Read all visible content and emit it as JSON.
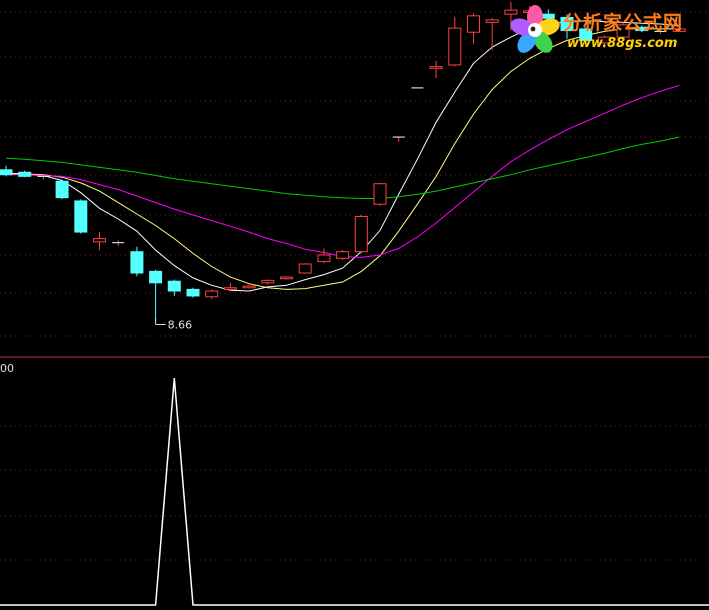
{
  "chart_data": [
    {
      "type": "candlestick",
      "title": "",
      "ylim": [
        8.3,
        12.5
      ],
      "bull_color": "#ff4040",
      "bear_color": "#54ffff",
      "min_marker": {
        "index": 8,
        "label": "8.66"
      },
      "candles": [
        {
          "o": 10.5,
          "h": 10.55,
          "l": 10.42,
          "c": 10.44
        },
        {
          "o": 10.47,
          "h": 10.49,
          "l": 10.41,
          "c": 10.42
        },
        {
          "o": 10.42,
          "h": 10.44,
          "l": 10.38,
          "c": 10.42
        },
        {
          "o": 10.36,
          "h": 10.38,
          "l": 10.14,
          "c": 10.16
        },
        {
          "o": 10.12,
          "h": 10.14,
          "l": 9.72,
          "c": 9.74
        },
        {
          "o": 9.62,
          "h": 9.74,
          "l": 9.52,
          "c": 9.66
        },
        {
          "o": 9.6,
          "h": 9.64,
          "l": 9.57,
          "c": 9.61
        },
        {
          "o": 9.5,
          "h": 9.56,
          "l": 9.2,
          "c": 9.24
        },
        {
          "o": 9.26,
          "h": 9.28,
          "l": 8.66,
          "c": 9.12
        },
        {
          "o": 9.14,
          "h": 9.16,
          "l": 8.96,
          "c": 9.02
        },
        {
          "o": 9.04,
          "h": 9.06,
          "l": 8.94,
          "c": 8.96
        },
        {
          "o": 8.95,
          "h": 9.04,
          "l": 8.92,
          "c": 9.02
        },
        {
          "o": 9.04,
          "h": 9.12,
          "l": 9.02,
          "c": 9.06
        },
        {
          "o": 9.06,
          "h": 9.1,
          "l": 9.05,
          "c": 9.08
        },
        {
          "o": 9.12,
          "h": 9.16,
          "l": 9.1,
          "c": 9.15
        },
        {
          "o": 9.17,
          "h": 9.2,
          "l": 9.16,
          "c": 9.19
        },
        {
          "o": 9.24,
          "h": 9.36,
          "l": 9.23,
          "c": 9.35
        },
        {
          "o": 9.38,
          "h": 9.54,
          "l": 9.36,
          "c": 9.46
        },
        {
          "o": 9.42,
          "h": 9.52,
          "l": 9.4,
          "c": 9.5
        },
        {
          "o": 9.5,
          "h": 9.95,
          "l": 9.48,
          "c": 9.93
        },
        {
          "o": 10.08,
          "h": 10.34,
          "l": 10.06,
          "c": 10.33
        },
        {
          "o": 10.9,
          "h": 10.9,
          "l": 10.84,
          "c": 10.9
        },
        {
          "o": 11.5,
          "h": 11.5,
          "l": 11.5,
          "c": 11.5
        },
        {
          "o": 11.74,
          "h": 11.83,
          "l": 11.62,
          "c": 11.76
        },
        {
          "o": 11.78,
          "h": 12.37,
          "l": 11.76,
          "c": 12.23
        },
        {
          "o": 12.18,
          "h": 12.41,
          "l": 12.04,
          "c": 12.38
        },
        {
          "o": 12.3,
          "h": 12.35,
          "l": 11.96,
          "c": 12.33
        },
        {
          "o": 12.4,
          "h": 12.55,
          "l": 12.2,
          "c": 12.45
        },
        {
          "o": 12.42,
          "h": 12.5,
          "l": 12.28,
          "c": 12.44
        },
        {
          "o": 12.4,
          "h": 12.46,
          "l": 12.3,
          "c": 12.35
        },
        {
          "o": 12.36,
          "h": 12.4,
          "l": 12.1,
          "c": 12.2
        },
        {
          "o": 12.22,
          "h": 12.24,
          "l": 12.02,
          "c": 12.08
        },
        {
          "o": 12.05,
          "h": 12.14,
          "l": 11.99,
          "c": 12.12
        },
        {
          "o": 12.12,
          "h": 12.3,
          "l": 12.1,
          "c": 12.27
        },
        {
          "o": 12.24,
          "h": 12.26,
          "l": 12.18,
          "c": 12.2
        },
        {
          "o": 12.18,
          "h": 12.2,
          "l": 12.16,
          "c": 12.19
        },
        {
          "o": 12.19,
          "h": 12.23,
          "l": 12.18,
          "c": 12.22
        }
      ],
      "ma_lines": [
        {
          "color": "#ffffff",
          "values": [
            10.45,
            10.44,
            10.43,
            10.37,
            10.22,
            10.03,
            9.9,
            9.75,
            9.52,
            9.33,
            9.18,
            9.09,
            9.03,
            9.02,
            9.07,
            9.09,
            9.16,
            9.22,
            9.3,
            9.5,
            9.76,
            10.2,
            10.63,
            11.08,
            11.45,
            11.8,
            12.0,
            12.12,
            12.23,
            12.29,
            12.3,
            12.32,
            12.31,
            12.3,
            12.29,
            12.28,
            12.26
          ]
        },
        {
          "color": "#ffff80",
          "values": [
            10.46,
            10.45,
            10.44,
            10.41,
            10.34,
            10.24,
            10.1,
            9.96,
            9.82,
            9.66,
            9.48,
            9.32,
            9.19,
            9.11,
            9.06,
            9.04,
            9.05,
            9.09,
            9.13,
            9.26,
            9.45,
            9.75,
            10.08,
            10.42,
            10.82,
            11.18,
            11.48,
            11.7,
            11.86,
            11.98,
            12.08,
            12.14,
            12.19,
            12.22,
            12.22,
            12.22,
            12.22
          ]
        },
        {
          "color": "#ff00ff",
          "values": [
            10.44,
            10.44,
            10.43,
            10.42,
            10.38,
            10.32,
            10.26,
            10.18,
            10.1,
            10.02,
            9.95,
            9.88,
            9.81,
            9.74,
            9.66,
            9.6,
            9.53,
            9.49,
            9.44,
            9.43,
            9.46,
            9.54,
            9.68,
            9.85,
            10.04,
            10.23,
            10.42,
            10.6,
            10.74,
            10.87,
            10.99,
            11.09,
            11.19,
            11.29,
            11.38,
            11.46,
            11.53
          ]
        },
        {
          "color": "#00cc00",
          "values": [
            10.64,
            10.63,
            10.61,
            10.59,
            10.56,
            10.53,
            10.5,
            10.47,
            10.43,
            10.39,
            10.36,
            10.33,
            10.3,
            10.27,
            10.24,
            10.21,
            10.19,
            10.17,
            10.16,
            10.15,
            10.15,
            10.17,
            10.2,
            10.24,
            10.29,
            10.34,
            10.39,
            10.44,
            10.5,
            10.55,
            10.6,
            10.65,
            10.7,
            10.76,
            10.81,
            10.85,
            10.9
          ]
        }
      ]
    },
    {
      "type": "line",
      "title": "",
      "y_axis_label": "00",
      "line_color": "#ffffff",
      "ylim": [
        0,
        100
      ],
      "values": [
        0,
        0,
        0,
        0,
        0,
        0,
        0,
        0,
        0,
        100,
        0,
        0,
        0,
        0,
        0,
        0,
        0,
        0,
        0,
        0,
        0,
        0,
        0,
        0,
        0,
        0,
        0,
        0,
        0,
        0,
        0,
        0,
        0,
        0,
        0,
        0,
        0
      ]
    }
  ],
  "watermark": {
    "title": "分析家公式网",
    "url": "www.88gs.com"
  }
}
